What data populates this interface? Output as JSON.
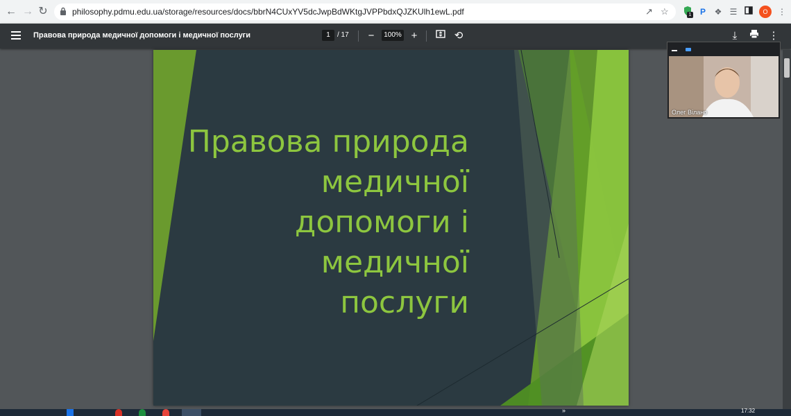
{
  "browser": {
    "url": "philosophy.pdmu.edu.ua/storage/resources/docs/bbrN4CUxYV5dcJwpBdWKtgJVPPbdxQJZKUlh1ewL.pdf",
    "extension_badge": "1",
    "profile_initial": "O",
    "icons": [
      "back-icon",
      "forward-icon",
      "reload-icon",
      "lock-icon",
      "share-icon",
      "star-icon",
      "extension-icon",
      "puzzle-icon",
      "media-icon",
      "sidepanel-icon",
      "more-icon"
    ]
  },
  "pdf_toolbar": {
    "title": "Правова природа медичної допомоги і медичної послуги",
    "page_current": "1",
    "page_total": "/ 17",
    "zoom": "100%"
  },
  "slide": {
    "title_lines": [
      "Правова природа",
      "медичної",
      "допомоги і",
      "медичної",
      "послуги"
    ],
    "colors": {
      "background": "#2b3a41",
      "accent": "#8dc63f"
    }
  },
  "video": {
    "participant_name": "Олег Вілано"
  },
  "taskbar": {
    "clock": "17:32",
    "chevron": "»"
  }
}
